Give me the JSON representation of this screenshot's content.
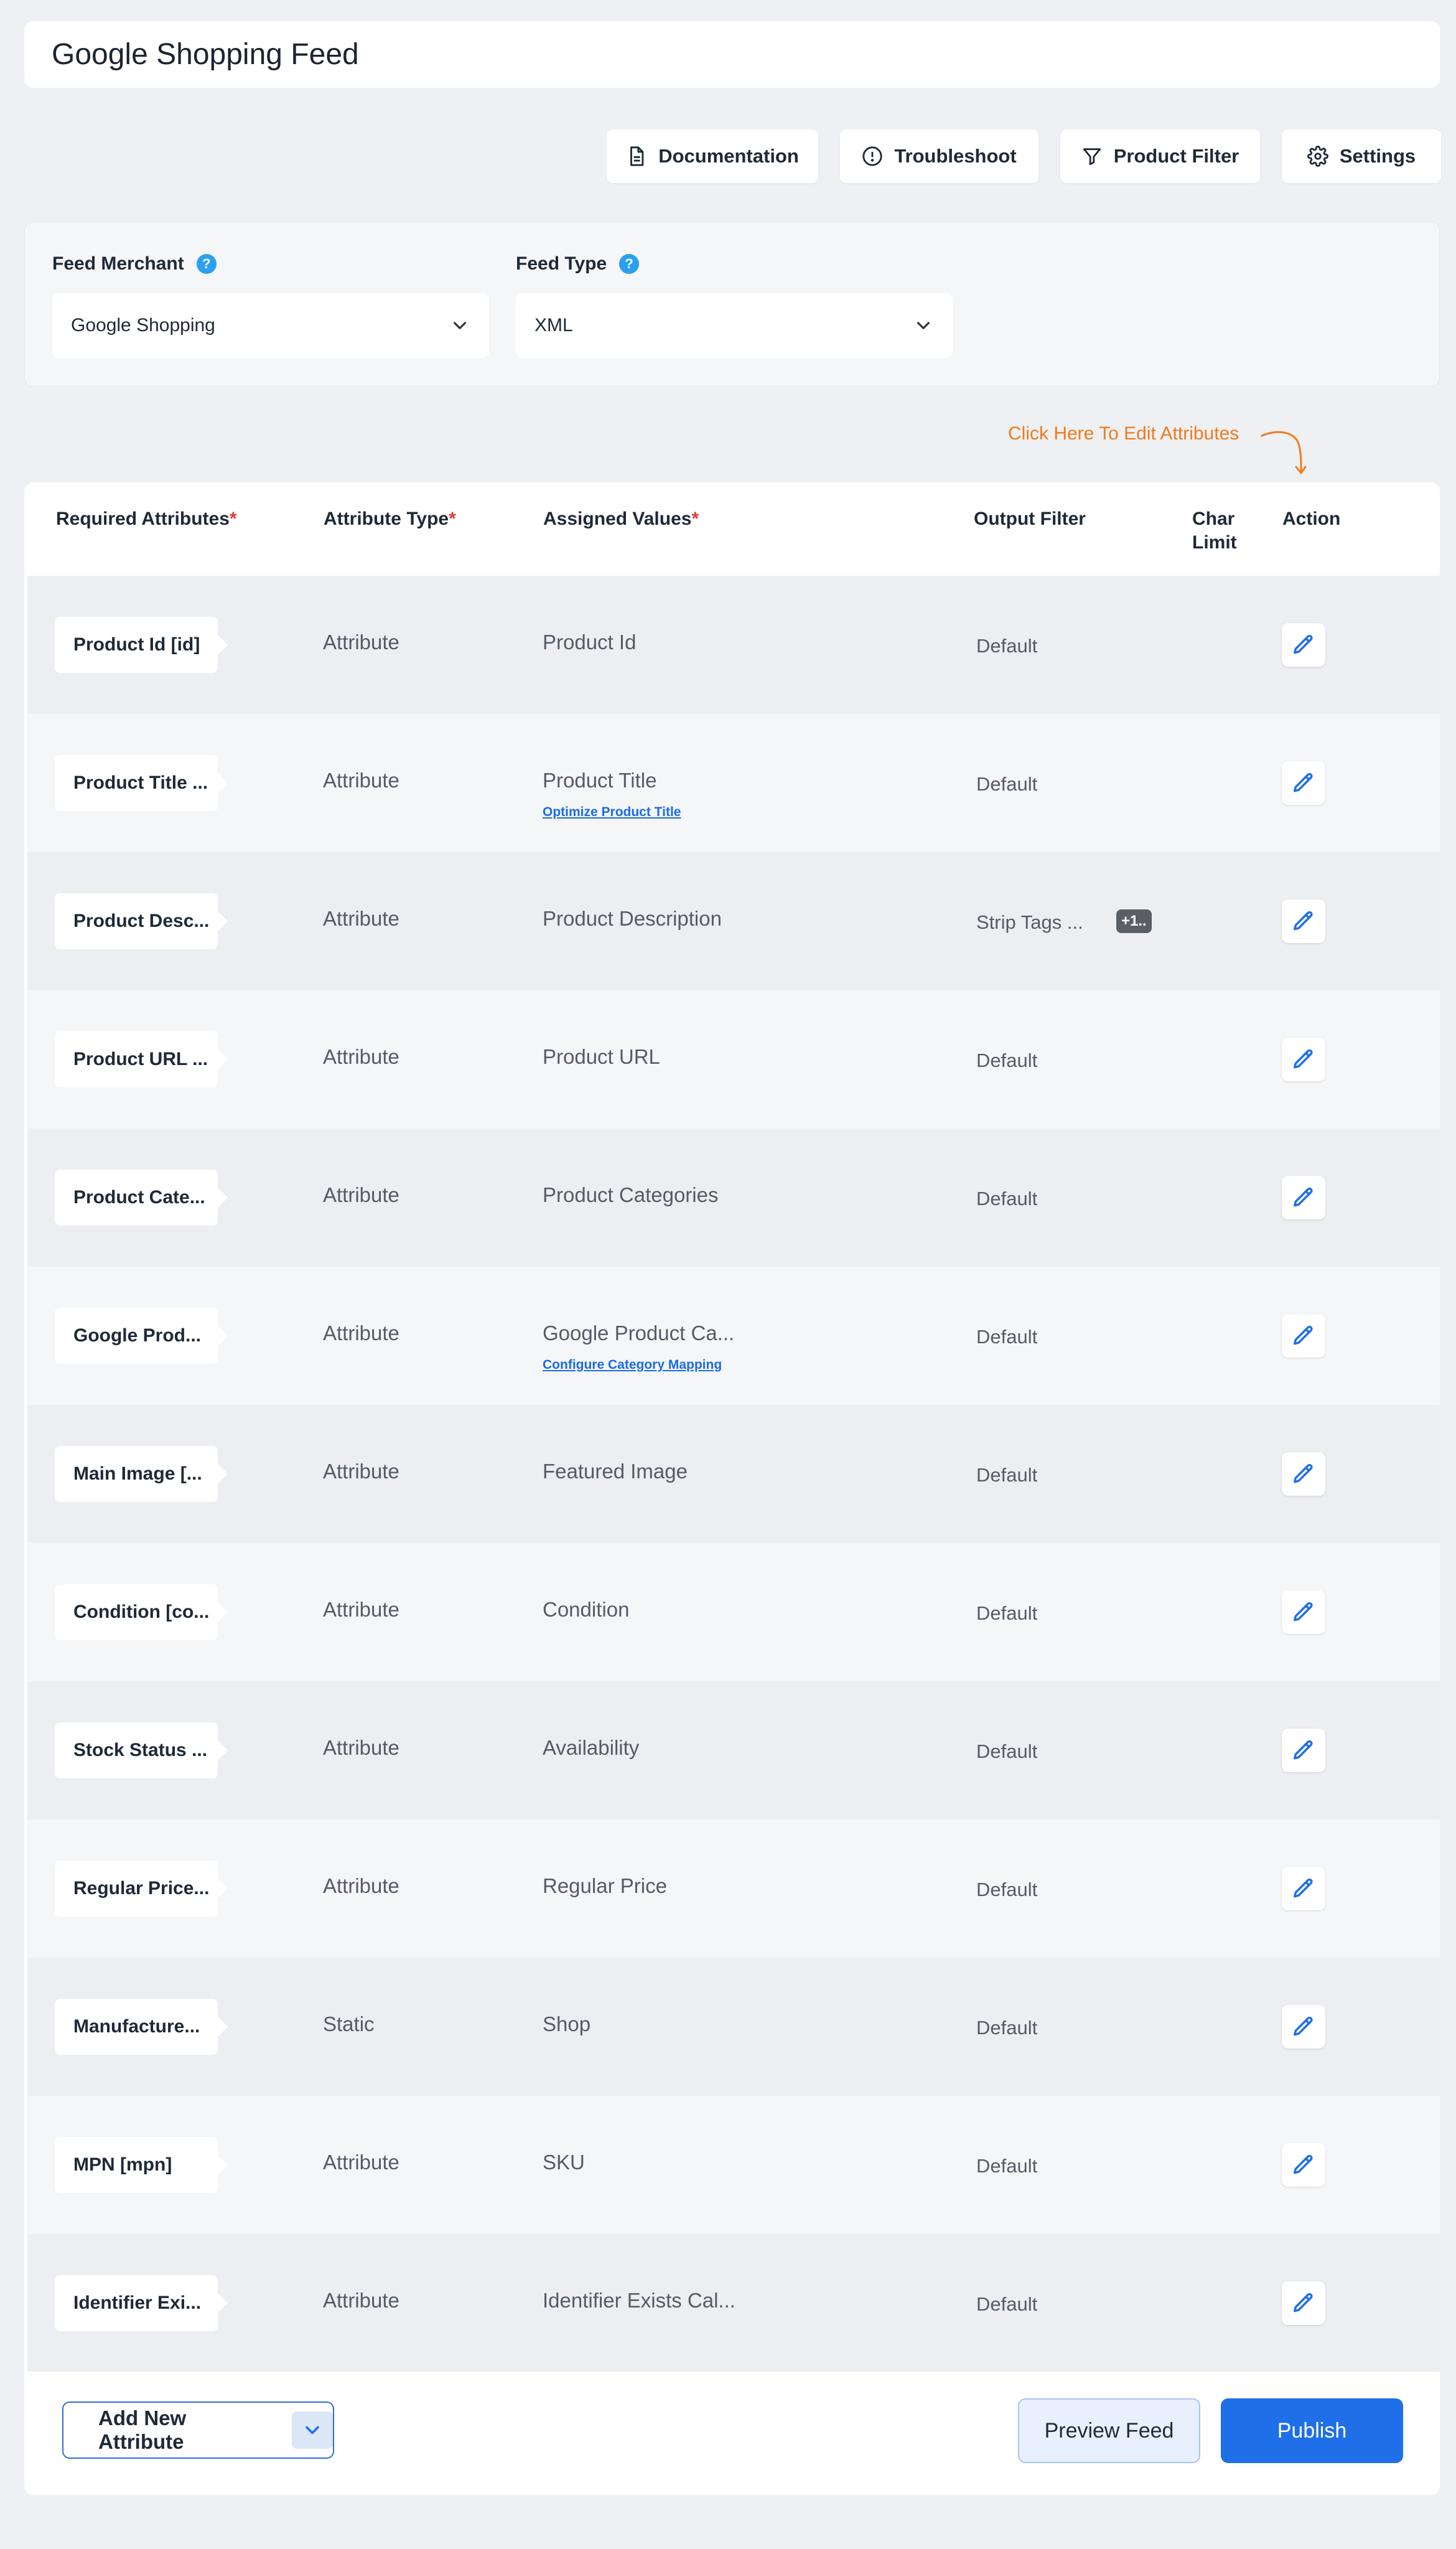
{
  "page": {
    "title": "Google Shopping Feed"
  },
  "toolbar": {
    "documentation": "Documentation",
    "troubleshoot": "Troubleshoot",
    "product_filter": "Product Filter",
    "settings": "Settings"
  },
  "merchant": {
    "merchant_label": "Feed Merchant",
    "merchant_value": "Google Shopping",
    "type_label": "Feed Type",
    "type_value": "XML",
    "help_symbol": "?"
  },
  "hint": {
    "text": "Click Here To Edit Attributes"
  },
  "table": {
    "headers": {
      "required": "Required Attributes",
      "type": "Attribute Type",
      "values": "Assigned Values",
      "filter": "Output Filter",
      "char_limit_1": "Char",
      "char_limit_2": "Limit",
      "action": "Action",
      "required_mark": "*"
    },
    "rows": [
      {
        "attribute": "Product Id [id]",
        "type": "Attribute",
        "value": "Product Id",
        "link": "",
        "filter": "Default",
        "badge": ""
      },
      {
        "attribute": "Product Title ...",
        "type": "Attribute",
        "value": "Product Title",
        "link": "Optimize Product Title",
        "filter": "Default",
        "badge": ""
      },
      {
        "attribute": "Product Desc...",
        "type": "Attribute",
        "value": "Product Description",
        "link": "",
        "filter": "Strip Tags ...",
        "badge": "+1.."
      },
      {
        "attribute": "Product URL ...",
        "type": "Attribute",
        "value": "Product URL",
        "link": "",
        "filter": "Default",
        "badge": ""
      },
      {
        "attribute": "Product Cate...",
        "type": "Attribute",
        "value": "Product Categories",
        "link": "",
        "filter": "Default",
        "badge": ""
      },
      {
        "attribute": "Google Prod...",
        "type": "Attribute",
        "value": "Google Product Ca...",
        "link": "Configure Category Mapping",
        "filter": "Default",
        "badge": ""
      },
      {
        "attribute": "Main Image [...",
        "type": "Attribute",
        "value": "Featured Image",
        "link": "",
        "filter": "Default",
        "badge": ""
      },
      {
        "attribute": "Condition [co...",
        "type": "Attribute",
        "value": "Condition",
        "link": "",
        "filter": "Default",
        "badge": ""
      },
      {
        "attribute": "Stock Status ...",
        "type": "Attribute",
        "value": "Availability",
        "link": "",
        "filter": "Default",
        "badge": ""
      },
      {
        "attribute": "Regular Price...",
        "type": "Attribute",
        "value": "Regular Price",
        "link": "",
        "filter": "Default",
        "badge": ""
      },
      {
        "attribute": "Manufacture...",
        "type": "Static",
        "value": "Shop",
        "link": "",
        "filter": "Default",
        "badge": ""
      },
      {
        "attribute": "MPN [mpn]",
        "type": "Attribute",
        "value": "SKU",
        "link": "",
        "filter": "Default",
        "badge": ""
      },
      {
        "attribute": "Identifier Exi...",
        "type": "Attribute",
        "value": "Identifier Exists Cal...",
        "link": "",
        "filter": "Default",
        "badge": ""
      }
    ]
  },
  "footer": {
    "add_attribute": "Add New Attribute",
    "preview": "Preview Feed",
    "publish": "Publish"
  },
  "colors": {
    "accent": "#1f6fe8",
    "hint": "#f07a1a",
    "required": "#e53935",
    "help": "#2aa0f0"
  }
}
